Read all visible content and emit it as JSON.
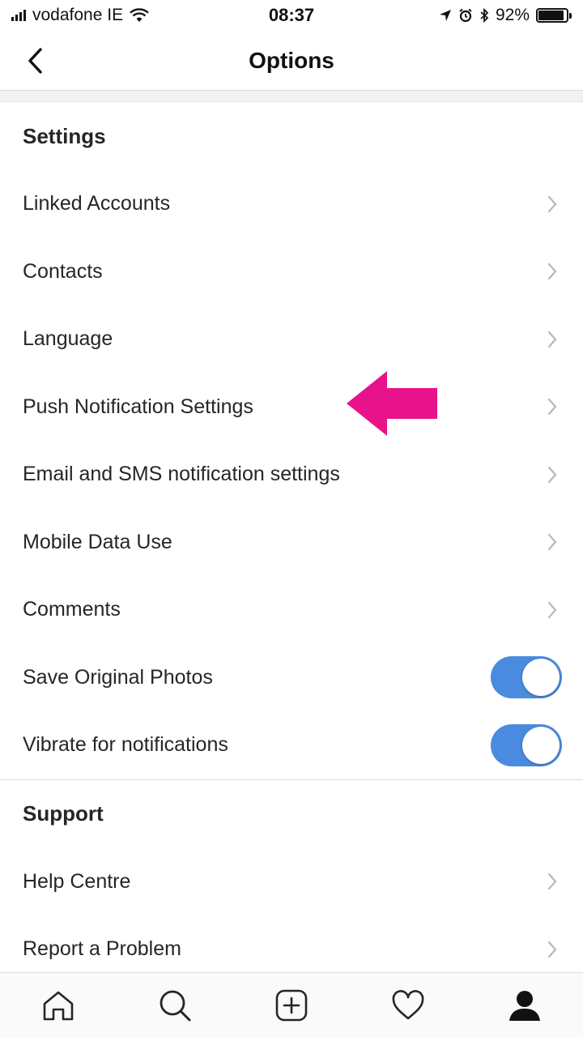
{
  "status_bar": {
    "carrier": "vodafone IE",
    "time": "08:37",
    "battery": "92%",
    "battery_level": 0.92
  },
  "nav": {
    "title": "Options",
    "back_icon": "chevron-left-icon"
  },
  "sections": {
    "settings": {
      "header": "Settings",
      "items": [
        {
          "label": "Linked Accounts",
          "type": "link"
        },
        {
          "label": "Contacts",
          "type": "link"
        },
        {
          "label": "Language",
          "type": "link"
        },
        {
          "label": "Push Notification Settings",
          "type": "link"
        },
        {
          "label": "Email and SMS notification settings",
          "type": "link"
        },
        {
          "label": "Mobile Data Use",
          "type": "link"
        },
        {
          "label": "Comments",
          "type": "link"
        },
        {
          "label": "Save Original Photos",
          "type": "toggle",
          "on": true
        },
        {
          "label": "Vibrate for notifications",
          "type": "toggle",
          "on": true
        }
      ]
    },
    "support": {
      "header": "Support",
      "items": [
        {
          "label": "Help Centre",
          "type": "link"
        },
        {
          "label": "Report a Problem",
          "type": "link"
        }
      ]
    }
  },
  "colors": {
    "toggle_on": "#4a8be0",
    "annotation_arrow": "#e8138b",
    "text": "#262626"
  },
  "tab_bar": {
    "tabs": [
      {
        "icon": "home-icon"
      },
      {
        "icon": "search-icon"
      },
      {
        "icon": "add-post-icon"
      },
      {
        "icon": "heart-icon"
      },
      {
        "icon": "profile-icon",
        "active": true
      }
    ]
  }
}
